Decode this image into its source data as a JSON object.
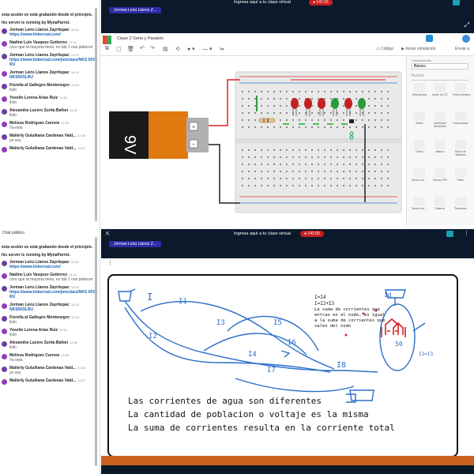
{
  "chat_top": {
    "system_lines": [
      "esta sesión se está grabando desde el principio.",
      "his server is running by MynaParrot."
    ],
    "messages": [
      {
        "name": "Jorman Leiru Llanos Zayritupac",
        "time": "14:31",
        "text": "https://www.tinkercad.com/",
        "link": true
      },
      {
        "name": "Nadine Luis Vasquez Gutierrez",
        "time": "14:31",
        "text": "creo que la mayoria tiene, en lab 1 nos pidieron",
        "link": false
      },
      {
        "name": "Jorman Leiru Llanos Zayritupac",
        "time": "14:33",
        "text": "https://www.tinkercad.com/joinclass/NKS 5K5LRU",
        "link": true
      },
      {
        "name": "Jorman Leiru Llanos Zayritupac",
        "time": "14:33",
        "text": "NKS5K5LRU",
        "link": true
      },
      {
        "name": "Fiorella al Gallegos Montenegro",
        "time": "14:34",
        "text": "listo",
        "link": false
      },
      {
        "name": "Yoselin Lorena Arias Ruiz",
        "time": "14:34",
        "text": "listo",
        "link": false
      },
      {
        "name": "Alexandra Lucero Zurita Ballon",
        "time": "14:34",
        "text": "listo",
        "link": false
      },
      {
        "name": "Melissa Rodriguez Carrera",
        "time": "14:35",
        "text": "Ya esta",
        "link": false
      },
      {
        "name": "Mallerly Guluiliana Cardenas Vald...",
        "time": "14:35",
        "text": "yo soy",
        "link": false
      },
      {
        "name": "Mallerly Guluiliana Cardenas Vald...",
        "time": "14:37",
        "text": "",
        "link": false
      }
    ]
  },
  "chat_bottom": {
    "header": "Chat público",
    "system_lines": [
      "esta sesión se está grabando desde el principio.",
      "his server is running by MynaParrot."
    ],
    "messages": [
      {
        "name": "Jorman Leiru Llanos Zayritupac",
        "time": "14:31",
        "text": "https://www.tinkercad.com/",
        "link": true
      },
      {
        "name": "Nadine Luis Vasquez Gutierrez",
        "time": "14:31",
        "text": "creo que la mayoria tiene, en lab 1 nos pidieron",
        "link": false
      },
      {
        "name": "Jorman Leiru Llanos Zayritupac",
        "time": "14:33",
        "text": "https://www.tinkercad.com/joinclass/NKS 5K5LRU",
        "link": true
      },
      {
        "name": "Jorman Leiru Llanos Zayritupac",
        "time": "14:33",
        "text": "NKS5K5LRU",
        "link": true
      },
      {
        "name": "Fiorella al Gallegos Montenegro",
        "time": "14:34",
        "text": "listo",
        "link": false
      },
      {
        "name": "Yoselin Lorena Arias Ruiz",
        "time": "14:34",
        "text": "listo",
        "link": false
      },
      {
        "name": "Alexandra Lucero Zurita Ballon",
        "time": "14:34",
        "text": "listo",
        "link": false
      },
      {
        "name": "Melissa Rodriguez Carrera",
        "time": "14:35",
        "text": "Ya esta",
        "link": false
      },
      {
        "name": "Mallerly Guluiliana Cardenas Vald...",
        "time": "14:35",
        "text": "yo soy",
        "link": false
      },
      {
        "name": "Mallerly Guluiliana Cardenas Vald...",
        "time": "14:37",
        "text": "",
        "link": false
      }
    ]
  },
  "meeting_top": {
    "presenter": "Jorman Leiru Llanos Z...",
    "banner": "Ingresa aquí a tu clase virtual",
    "timer": "141:15"
  },
  "meeting_bottom": {
    "presenter": "Jorman Leiru Llanos Z...",
    "banner": "Ingresa aquí a tu clase virtual",
    "timer": "142:00"
  },
  "tinkercad": {
    "title": "Clase 2 Serie y Paralelo",
    "code_label": "Código",
    "sim_label": "Iniciar simulación",
    "send_label": "Enviar a",
    "components_label": "Componentes",
    "components_value": "Básico",
    "search_placeholder": "Buscar",
    "battery_label": "9V",
    "parts": [
      "Resistencia",
      "Motor de CC",
      "Potenciómetro",
      "Botón",
      "Interruptor deslizante",
      "Fotorresistor",
      "Diodo",
      "Altavoz",
      "Motor de vibración",
      "Sensor de ...",
      "Sensor PIR",
      "Piezo",
      "Sensor de ...",
      "Batería",
      "Transistor"
    ]
  },
  "whiteboard": {
    "eq1": "I=I4",
    "eq2": "I=I2+I3",
    "note": [
      "La suma de corrientes que",
      "entran en el nodo, es igual",
      "a la suma de corrientes que",
      "salen del nodo"
    ],
    "labels": [
      "I",
      "I1",
      "I2",
      "I3",
      "I4",
      "I5",
      "I6",
      "I7",
      "I8",
      "I3",
      "Id"
    ],
    "node_label": "50",
    "side_eq": "I2=I3",
    "lines": [
      "Las corrientes de agua son diferentes",
      "La cantidad de poblacion o voltaje es la misma",
      "La suma de corrientes resulta en la corriente total"
    ]
  },
  "colors": {
    "dark_bar": "#0b1a2a",
    "accent": "#2f2aa8",
    "timer": "#c81e1e",
    "pen_blue": "#2a6fc9"
  }
}
